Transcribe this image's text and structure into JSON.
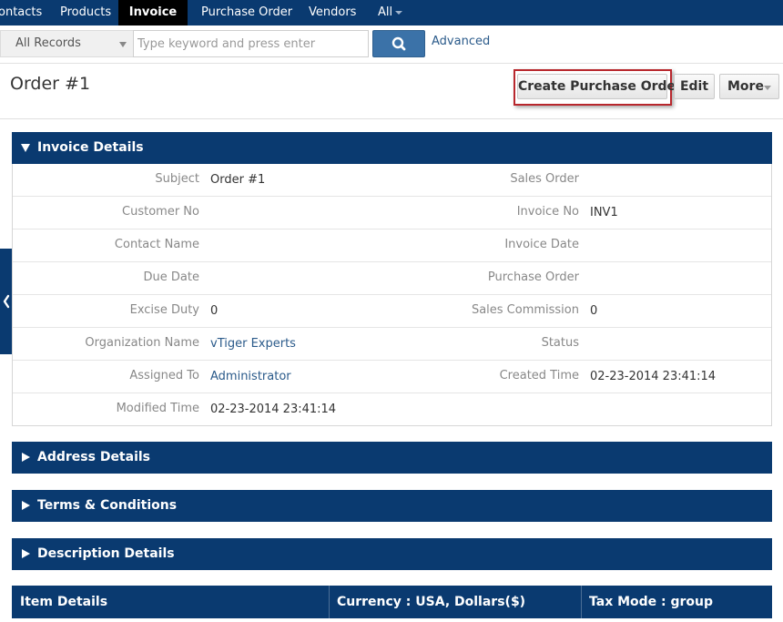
{
  "nav": {
    "tabs": [
      {
        "label": "ontacts"
      },
      {
        "label": "Products"
      },
      {
        "label": "Invoice"
      },
      {
        "label": "Purchase Order"
      },
      {
        "label": "Vendors"
      },
      {
        "label": "All"
      }
    ],
    "active_tab": "Invoice"
  },
  "search": {
    "records_label": "All Records",
    "placeholder": "Type keyword and press enter",
    "value": "",
    "advanced_label": "Advanced",
    "button_icon": "search-icon"
  },
  "header": {
    "title": "Order #1",
    "create_po_label": "Create Purchase Order",
    "edit_label": "Edit",
    "more_label": "More"
  },
  "invoice_details": {
    "title": "Invoice Details",
    "rows": [
      {
        "l1": "Subject",
        "v1": "Order #1",
        "l2": "Sales Order",
        "v2": ""
      },
      {
        "l1": "Customer No",
        "v1": "",
        "l2": "Invoice No",
        "v2": "INV1"
      },
      {
        "l1": "Contact Name",
        "v1": "",
        "l2": "Invoice Date",
        "v2": ""
      },
      {
        "l1": "Due Date",
        "v1": "",
        "l2": "Purchase Order",
        "v2": ""
      },
      {
        "l1": "Excise Duty",
        "v1": "0",
        "l2": "Sales Commission",
        "v2": "0"
      },
      {
        "l1": "Organization Name",
        "v1": "vTiger Experts",
        "l2": "Status",
        "v2": ""
      },
      {
        "l1": "Assigned To",
        "v1": "Administrator",
        "l2": "Created Time",
        "v2": "02-23-2014 23:41:14"
      },
      {
        "l1": "Modified Time",
        "v1": "02-23-2014 23:41:14",
        "l2": "",
        "v2": ""
      }
    ]
  },
  "collapsed_panels": {
    "address": "Address Details",
    "terms": "Terms & Conditions",
    "description": "Description Details"
  },
  "item_details": {
    "title": "Item Details",
    "currency": "Currency : USA, Dollars($)",
    "tax_mode": "Tax Mode : group"
  },
  "colors": {
    "nav_bg": "#0a3a70",
    "active_tab_bg": "#000000",
    "accent_button": "#3b72a8",
    "link": "#2a5a8a",
    "highlight_border": "#b8272d"
  }
}
